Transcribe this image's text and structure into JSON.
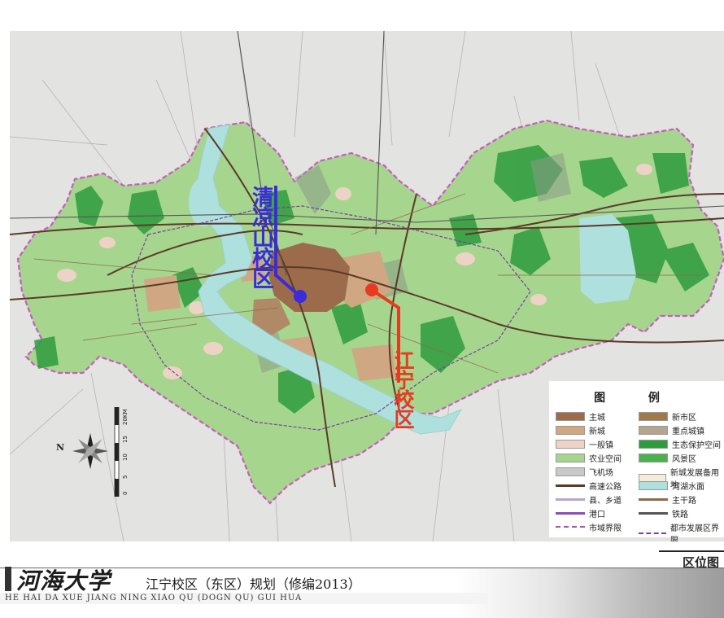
{
  "map": {
    "campus_qinglongshan": "清凉山校区",
    "campus_jiangning": "江宁校区",
    "marker_colors": {
      "qinglongshan": "#3a2bdc",
      "jiangning": "#e83a20"
    }
  },
  "compass": {
    "north_letter": "N"
  },
  "scale": {
    "start": "0",
    "marks": [
      "5",
      "10",
      "15",
      "20KM"
    ]
  },
  "legend": {
    "title": "图 例",
    "items": [
      {
        "label": "主城",
        "color": "#9b6b4b"
      },
      {
        "label": "新市区",
        "color": "#a07a4a"
      },
      {
        "label": "新城",
        "color": "#cfa883"
      },
      {
        "label": "重点城镇",
        "color": "#b5a48e"
      },
      {
        "label": "一般镇",
        "color": "#edd3c5"
      },
      {
        "label": "生态保护空间",
        "color": "#2e9b3e"
      },
      {
        "label": "农业空间",
        "color": "#a6d58e"
      },
      {
        "label": "风景区",
        "color": "#4caf50"
      },
      {
        "label": "飞机场",
        "color": "#c9c9c9"
      },
      {
        "label": "新城发展备用地",
        "color": "#f3ecd6"
      },
      {
        "label": "高速公路",
        "color": "#5b3a28"
      },
      {
        "label": "河湖水面",
        "color": "#aee0de"
      },
      {
        "label": "县、乡道",
        "color": "#b8a6c8"
      },
      {
        "label": "主干路",
        "color": "#8b6b4b"
      },
      {
        "label": "港口",
        "color": "#8a4fb3"
      },
      {
        "label": "铁路",
        "color": "#555555"
      },
      {
        "label": "市域界限",
        "color": "#b04fb0"
      },
      {
        "label": "都市发展区界限",
        "color": "#7a3f9a"
      }
    ]
  },
  "sheet": {
    "label": "区位图"
  },
  "footer": {
    "university": "河海大学",
    "title": "江宁校区（东区）规划（修编2013）",
    "pinyin": "HE HAI DA XUE  JIANG NING XIAO QU (DOGN QU) GUI HUA"
  }
}
